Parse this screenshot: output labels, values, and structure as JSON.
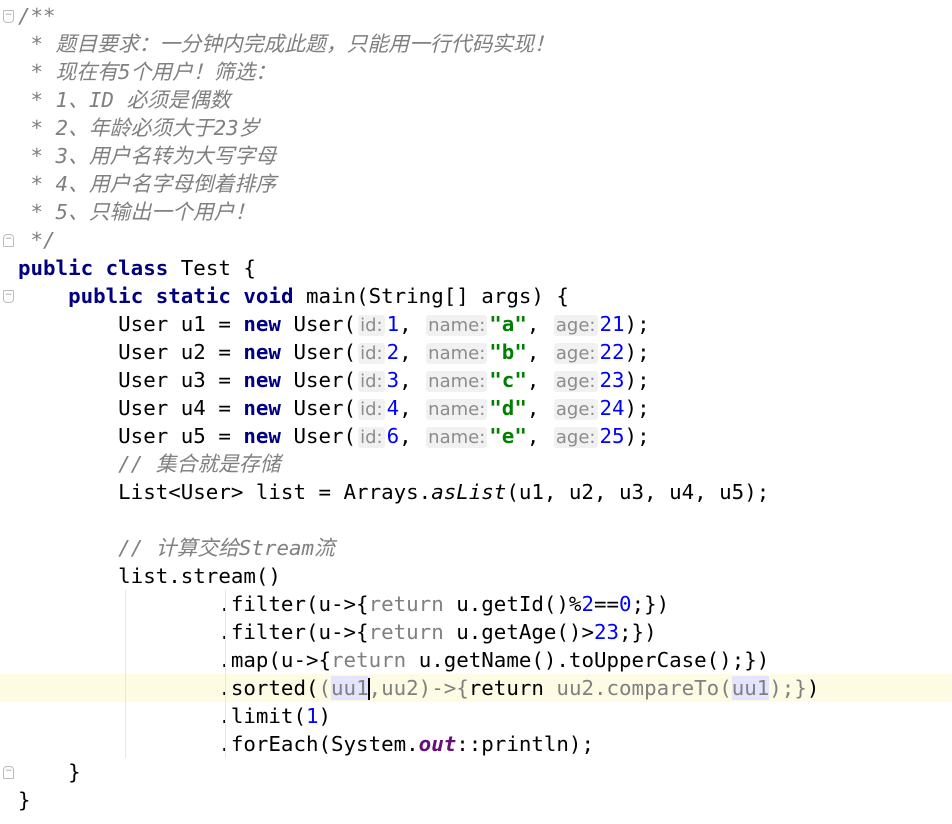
{
  "editor": {
    "language": "java",
    "current_line": 24,
    "caret_after_token": "uu1",
    "colors": {
      "keyword": "#000080",
      "number": "#0000ff",
      "string": "#008000",
      "comment": "#808080",
      "static_field": "#660e7a",
      "current_line_bg": "#fdfbe4",
      "usage_highlight": "#e4e4ff"
    },
    "fold_markers": [
      0,
      8,
      10,
      27
    ],
    "lines": [
      [
        [
          "c",
          "/**"
        ]
      ],
      [
        [
          "c",
          " * 题目要求：一分钟内完成此题，只能用一行代码实现！"
        ]
      ],
      [
        [
          "c",
          " * 现在有5个用户！筛选："
        ]
      ],
      [
        [
          "c",
          " * 1、ID 必须是偶数"
        ]
      ],
      [
        [
          "c",
          " * 2、年龄必须大于23岁"
        ]
      ],
      [
        [
          "c",
          " * 3、用户名转为大写字母"
        ]
      ],
      [
        [
          "c",
          " * 4、用户名字母倒着排序"
        ]
      ],
      [
        [
          "c",
          " * 5、只输出一个用户！"
        ]
      ],
      [
        [
          "c",
          " */"
        ]
      ],
      [
        [
          "k",
          "public class "
        ],
        [
          "p",
          "Test {"
        ]
      ],
      [
        [
          "p",
          "    "
        ],
        [
          "k",
          "public static void "
        ],
        [
          "p",
          "main(String[] args) {"
        ]
      ],
      [
        [
          "p",
          "        User u1 = "
        ],
        [
          "k",
          "new "
        ],
        [
          "p",
          "User("
        ],
        [
          "h",
          "id:"
        ],
        [
          "n",
          "1"
        ],
        [
          "p",
          ", "
        ],
        [
          "h",
          "name:"
        ],
        [
          "s",
          "\"a\""
        ],
        [
          "p",
          ", "
        ],
        [
          "h",
          "age:"
        ],
        [
          "n",
          "21"
        ],
        [
          "p",
          ");"
        ]
      ],
      [
        [
          "p",
          "        User u2 = "
        ],
        [
          "k",
          "new "
        ],
        [
          "p",
          "User("
        ],
        [
          "h",
          "id:"
        ],
        [
          "n",
          "2"
        ],
        [
          "p",
          ", "
        ],
        [
          "h",
          "name:"
        ],
        [
          "s",
          "\"b\""
        ],
        [
          "p",
          ", "
        ],
        [
          "h",
          "age:"
        ],
        [
          "n",
          "22"
        ],
        [
          "p",
          ");"
        ]
      ],
      [
        [
          "p",
          "        User u3 = "
        ],
        [
          "k",
          "new "
        ],
        [
          "p",
          "User("
        ],
        [
          "h",
          "id:"
        ],
        [
          "n",
          "3"
        ],
        [
          "p",
          ", "
        ],
        [
          "h",
          "name:"
        ],
        [
          "s",
          "\"c\""
        ],
        [
          "p",
          ", "
        ],
        [
          "h",
          "age:"
        ],
        [
          "n",
          "23"
        ],
        [
          "p",
          ");"
        ]
      ],
      [
        [
          "p",
          "        User u4 = "
        ],
        [
          "k",
          "new "
        ],
        [
          "p",
          "User("
        ],
        [
          "h",
          "id:"
        ],
        [
          "n",
          "4"
        ],
        [
          "p",
          ", "
        ],
        [
          "h",
          "name:"
        ],
        [
          "s",
          "\"d\""
        ],
        [
          "p",
          ", "
        ],
        [
          "h",
          "age:"
        ],
        [
          "n",
          "24"
        ],
        [
          "p",
          ");"
        ]
      ],
      [
        [
          "p",
          "        User u5 = "
        ],
        [
          "k",
          "new "
        ],
        [
          "p",
          "User("
        ],
        [
          "h",
          "id:"
        ],
        [
          "n",
          "6"
        ],
        [
          "p",
          ", "
        ],
        [
          "h",
          "name:"
        ],
        [
          "s",
          "\"e\""
        ],
        [
          "p",
          ", "
        ],
        [
          "h",
          "age:"
        ],
        [
          "n",
          "25"
        ],
        [
          "p",
          ");"
        ]
      ],
      [
        [
          "c",
          "        // 集合就是存储"
        ]
      ],
      [
        [
          "p",
          "        List<User> list = Arrays."
        ],
        [
          "i",
          "asList"
        ],
        [
          "p",
          "(u1, u2, u3, u4, u5);"
        ]
      ],
      [],
      [
        [
          "c",
          "        // 计算交给Stream流"
        ]
      ],
      [
        [
          "p",
          "        list.stream()"
        ]
      ],
      [
        [
          "p",
          "                .filter(u->{"
        ],
        [
          "g",
          "return "
        ],
        [
          "p",
          "u.getId()%"
        ],
        [
          "n",
          "2"
        ],
        [
          "p",
          "=="
        ],
        [
          "n",
          "0"
        ],
        [
          "p",
          ";})"
        ]
      ],
      [
        [
          "p",
          "                .filter(u->{"
        ],
        [
          "g",
          "return "
        ],
        [
          "p",
          "u.getAge()>"
        ],
        [
          "n",
          "23"
        ],
        [
          "p",
          ";})"
        ]
      ],
      [
        [
          "p",
          "                .map(u->{"
        ],
        [
          "g",
          "return "
        ],
        [
          "p",
          "u.getName().toUpperCase();})"
        ]
      ],
      [
        [
          "p",
          "                .sorted("
        ],
        [
          "g",
          "("
        ],
        [
          "gh",
          "uu1"
        ],
        [
          "g",
          ",uu2)->{"
        ],
        [
          "p",
          "return "
        ],
        [
          "g",
          "uu2.compareTo("
        ],
        [
          "gh",
          "uu1"
        ],
        [
          "g",
          ");}"
        ],
        [
          "p",
          ")"
        ]
      ],
      [
        [
          "p",
          "                .limit("
        ],
        [
          "n",
          "1"
        ],
        [
          "p",
          ")"
        ]
      ],
      [
        [
          "p",
          "                .forEach(System."
        ],
        [
          "o",
          "out"
        ],
        [
          "p",
          "::println);"
        ]
      ],
      [
        [
          "p",
          "    }"
        ]
      ],
      [
        [
          "p",
          "}"
        ]
      ]
    ]
  }
}
